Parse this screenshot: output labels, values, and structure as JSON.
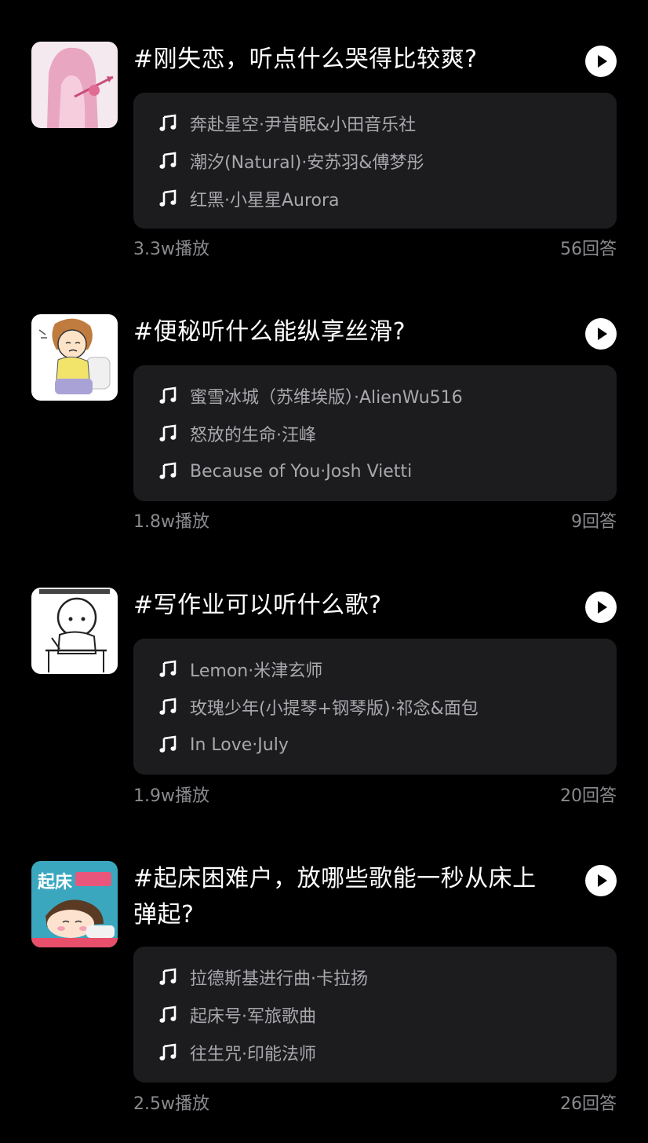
{
  "topics": [
    {
      "title": "#刚失恋，听点什么哭得比较爽?",
      "thumb_icon": "heartbroken-girl-image",
      "songs": [
        "奔赴星空·尹昔眠&小田音乐社",
        "潮汐(Natural)·安苏羽&傅梦彤",
        "红黑·小星星Aurora"
      ],
      "plays": "3.3w播放",
      "answers": "56回答"
    },
    {
      "title": "#便秘听什么能纵享丝滑?",
      "thumb_icon": "cartoon-girl-toilet-image",
      "songs": [
        "蜜雪冰城（苏维埃版）·AlienWu516",
        "怒放的生命·汪峰",
        "Because of You·Josh Vietti"
      ],
      "plays": "1.8w播放",
      "answers": "9回答"
    },
    {
      "title": "#写作业可以听什么歌?",
      "thumb_icon": "cartoon-doing-homework-image",
      "songs": [
        "Lemon·米津玄师",
        "玫瑰少年(小提琴+钢琴版)·祁念&面包",
        "In Love·July"
      ],
      "plays": "1.9w播放",
      "answers": "20回答"
    },
    {
      "title": "#起床困难户，放哪些歌能一秒从床上弹起?",
      "thumb_icon": "cartoon-girl-bed-image",
      "thumb_text": "起床",
      "songs": [
        "拉德斯基进行曲·卡拉扬",
        "起床号·军旅歌曲",
        "往生咒·印能法师"
      ],
      "plays": "2.5w播放",
      "answers": "26回答"
    }
  ],
  "colors": {
    "background": "#000000",
    "card": "#1c1c1e",
    "song_text": "#a8a8ad",
    "meta_text": "#8a8a8f",
    "title_text": "#ffffff"
  }
}
